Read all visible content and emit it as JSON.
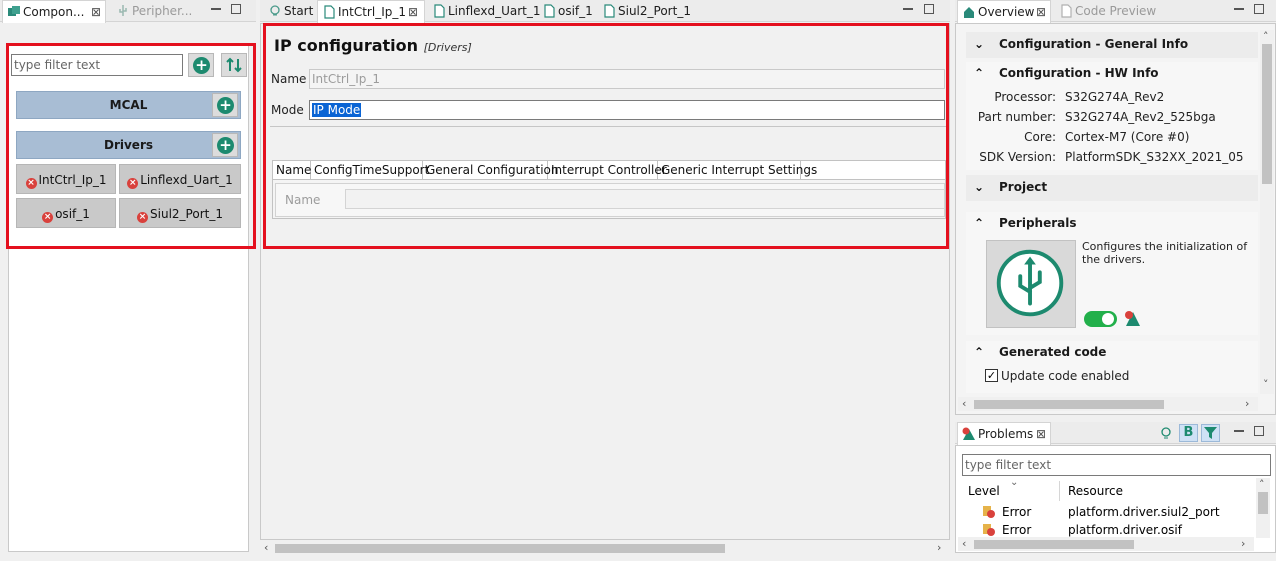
{
  "left_panel": {
    "tabs": [
      {
        "label": "Compon...",
        "active": true
      },
      {
        "label": "Peripher...",
        "active": false
      }
    ],
    "filter_placeholder": "type filter text",
    "groups": [
      {
        "label": "MCAL",
        "components": []
      },
      {
        "label": "Drivers",
        "components": [
          {
            "label": "IntCtrl_Ip_1",
            "status": "error"
          },
          {
            "label": "Linflexd_Uart_1",
            "status": "error"
          },
          {
            "label": "osif_1",
            "status": "error"
          },
          {
            "label": "Siul2_Port_1",
            "status": "error"
          }
        ]
      }
    ]
  },
  "editor": {
    "tabs": [
      {
        "label": "Start"
      },
      {
        "label": "IntCtrl_Ip_1",
        "active": true
      },
      {
        "label": "Linflexd_Uart_1"
      },
      {
        "label": "osif_1"
      },
      {
        "label": "Siul2_Port_1"
      }
    ],
    "title": "IP configuration",
    "subtitle": "[Drivers]",
    "name_label": "Name",
    "name_value": "IntCtrl_Ip_1",
    "mode_label": "Mode",
    "mode_value": "IP Mode",
    "config_tabs": [
      "Name",
      "ConfigTimeSupport",
      "General Configuration",
      "Interrupt Controller",
      "Generic Interrupt Settings"
    ],
    "inner_name_label": "Name"
  },
  "overview": {
    "tabs": [
      {
        "label": "Overview",
        "active": true
      },
      {
        "label": "Code Preview",
        "active": false
      }
    ],
    "sections": {
      "general": "Configuration - General Info",
      "hw": "Configuration - HW Info",
      "project": "Project",
      "peripherals": "Peripherals",
      "generated": "Generated code"
    },
    "hw_info": [
      {
        "key": "Processor:",
        "value": "S32G274A_Rev2"
      },
      {
        "key": "Part number:",
        "value": "S32G274A_Rev2_525bga"
      },
      {
        "key": "Core:",
        "value": "Cortex-M7 (Core #0)"
      },
      {
        "key": "SDK Version:",
        "value": "PlatformSDK_S32XX_2021_05"
      }
    ],
    "peripherals_desc": "Configures the initialization of the drivers.",
    "update_code_label": "Update code enabled"
  },
  "problems": {
    "tab_label": "Problems",
    "filter_placeholder": "type filter text",
    "columns": [
      "Level",
      "Resource"
    ],
    "rows": [
      {
        "level": "Error",
        "resource": "platform.driver.siul2_port"
      },
      {
        "level": "Error",
        "resource": "platform.driver.osif"
      }
    ],
    "filter_button_label": "B"
  },
  "colors": {
    "highlight_red": "#e4101e",
    "accent_green": "#1d8a6f",
    "group_blue": "#a8bdd4"
  }
}
